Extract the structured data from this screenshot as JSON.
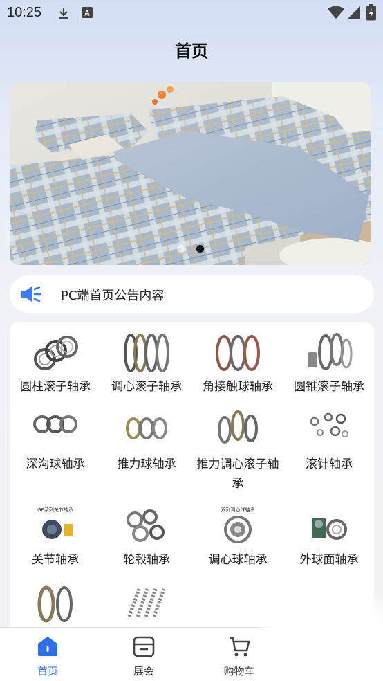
{
  "status": {
    "time": "10:25"
  },
  "header": {
    "title": "首页"
  },
  "banner": {
    "slide_count": 2,
    "active_slide": 2
  },
  "notice": {
    "text": "PC端首页公告内容"
  },
  "categories": [
    {
      "label": "圆柱滚子轴承",
      "icon": "cylindrical-roller-bearing-image"
    },
    {
      "label": "调心滚子轴承",
      "icon": "spherical-roller-bearing-image"
    },
    {
      "label": "角接触球轴承",
      "icon": "angular-contact-ball-bearing-image"
    },
    {
      "label": "圆锥滚子轴承",
      "icon": "tapered-roller-bearing-image"
    },
    {
      "label": "深沟球轴承",
      "icon": "deep-groove-ball-bearing-image"
    },
    {
      "label": "推力球轴承",
      "icon": "thrust-ball-bearing-image"
    },
    {
      "label": "推力调心滚子轴承",
      "icon": "thrust-spherical-roller-bearing-image"
    },
    {
      "label": "滚针轴承",
      "icon": "needle-roller-bearing-image"
    },
    {
      "label": "关节轴承",
      "icon": "plain-bearing-image",
      "image_text": "GE系列关节轴承"
    },
    {
      "label": "轮毂轴承",
      "icon": "hub-bearing-image"
    },
    {
      "label": "调心球轴承",
      "icon": "self-aligning-ball-bearing-image",
      "image_text": "双列调心球轴承"
    },
    {
      "label": "外球面轴承",
      "icon": "insert-bearing-image"
    },
    {
      "label": "",
      "icon": "bearing-image-13"
    },
    {
      "label": "",
      "icon": "bearing-image-14"
    }
  ],
  "tabbar": {
    "items": [
      {
        "label": "首页",
        "icon": "home-icon",
        "active": true
      },
      {
        "label": "展会",
        "icon": "exhibition-icon",
        "active": false
      },
      {
        "label": "购物车",
        "icon": "cart-icon",
        "active": false
      }
    ]
  },
  "colors": {
    "accent": "#2c6fe8",
    "notice_icon": "#3a7bf0",
    "background": "#f1f2f6"
  }
}
